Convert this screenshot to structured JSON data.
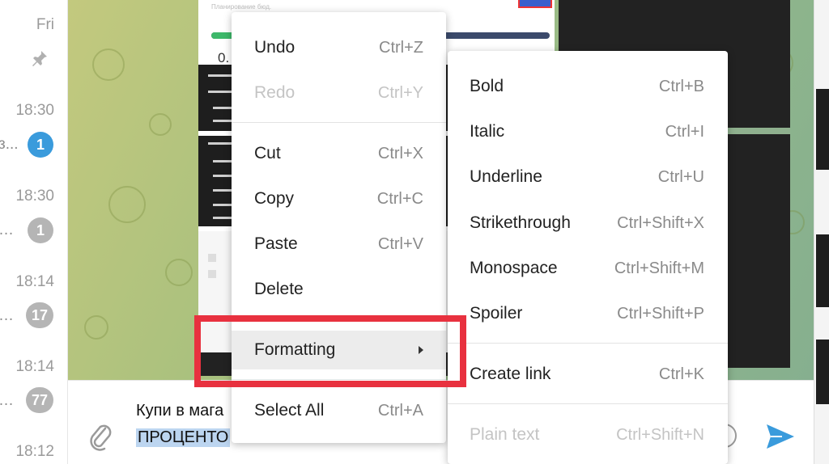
{
  "chat_list": {
    "day_label": "Fri",
    "items": [
      {
        "time": "18:30",
        "preview": "з...",
        "badge": "1",
        "badge_color": "#3a9bdc"
      },
      {
        "time": "18:30",
        "preview": "…",
        "badge": "1",
        "badge_color": "#b5b5b5"
      },
      {
        "time": "18:14",
        "preview": "…",
        "badge": "17",
        "badge_color": "#b5b5b5"
      },
      {
        "time": "18:14",
        "preview": "…",
        "badge": "77",
        "badge_color": "#b5b5b5"
      },
      {
        "time": "18:12",
        "preview": "",
        "badge": "",
        "badge_color": "#b5b5b5"
      }
    ]
  },
  "composer": {
    "line1": "Купи в мага",
    "line2_selected": "ПРОЦЕНТО"
  },
  "image_message": {
    "header_text": "Планирование бюд.",
    "value_text": "0.",
    "progress_fraction": 0.07,
    "accent_color": "#3db86a"
  },
  "context_menu": {
    "items": [
      {
        "label": "Undo",
        "shortcut": "Ctrl+Z",
        "disabled": false
      },
      {
        "label": "Redo",
        "shortcut": "Ctrl+Y",
        "disabled": true
      },
      {
        "label": "Cut",
        "shortcut": "Ctrl+X",
        "disabled": false
      },
      {
        "label": "Copy",
        "shortcut": "Ctrl+C",
        "disabled": false
      },
      {
        "label": "Paste",
        "shortcut": "Ctrl+V",
        "disabled": false
      },
      {
        "label": "Delete",
        "shortcut": "",
        "disabled": false
      },
      {
        "label": "Formatting",
        "shortcut": "",
        "disabled": false,
        "has_submenu": true,
        "active": true
      },
      {
        "label": "Select All",
        "shortcut": "Ctrl+A",
        "disabled": false
      }
    ]
  },
  "formatting_submenu": {
    "items": [
      {
        "label": "Bold",
        "shortcut": "Ctrl+B",
        "disabled": false
      },
      {
        "label": "Italic",
        "shortcut": "Ctrl+I",
        "disabled": false
      },
      {
        "label": "Underline",
        "shortcut": "Ctrl+U",
        "disabled": false
      },
      {
        "label": "Strikethrough",
        "shortcut": "Ctrl+Shift+X",
        "disabled": false
      },
      {
        "label": "Monospace",
        "shortcut": "Ctrl+Shift+M",
        "disabled": false
      },
      {
        "label": "Spoiler",
        "shortcut": "Ctrl+Shift+P",
        "disabled": false
      },
      {
        "label": "Create link",
        "shortcut": "Ctrl+K",
        "disabled": false
      },
      {
        "label": "Plain text",
        "shortcut": "Ctrl+Shift+N",
        "disabled": true
      }
    ]
  },
  "colors": {
    "highlight_annotation": "#e8313f",
    "send_icon": "#3a9bdc",
    "selection": "#bcd5f0"
  }
}
